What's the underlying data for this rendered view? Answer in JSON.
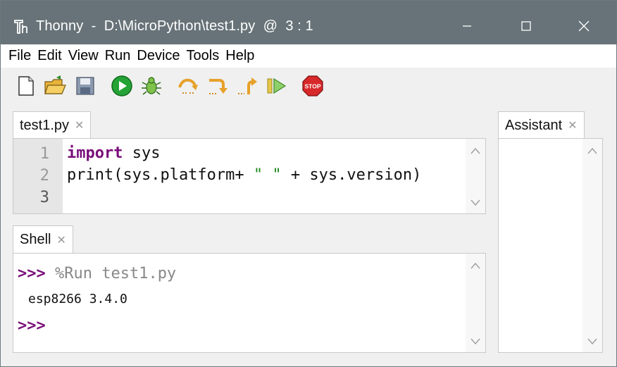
{
  "window": {
    "title": "Thonny  -  D:\\MicroPython\\test1.py  @  3 : 1"
  },
  "menu": [
    "File",
    "Edit",
    "View",
    "Run",
    "Device",
    "Tools",
    "Help"
  ],
  "toolbar": {
    "icons": [
      "new-file-icon",
      "open-folder-icon",
      "save-icon",
      "run-icon",
      "debug-bug-icon",
      "step-over-icon",
      "step-into-icon",
      "step-out-icon",
      "resume-icon",
      "stop-icon"
    ],
    "stop_label": "STOP"
  },
  "editor": {
    "tab_label": "test1.py",
    "line_numbers": [
      "1",
      "2",
      "3"
    ],
    "lines": {
      "l1_kw": "import",
      "l1_rest": " sys",
      "l2_a": "print(sys.platform+ ",
      "l2_str": "\" \"",
      "l2_b": " + sys.version)"
    }
  },
  "shell": {
    "tab_label": "Shell",
    "prompt": ">>>",
    "command": " %Run test1.py",
    "output": "esp8266 3.4.0",
    "prompt2": ">>>"
  },
  "assistant": {
    "tab_label": "Assistant"
  },
  "colors": {
    "titlebar": "#677378",
    "keyword": "#7a0f7a",
    "string": "#1b8a1b",
    "gutter": "#e6e6e6"
  }
}
